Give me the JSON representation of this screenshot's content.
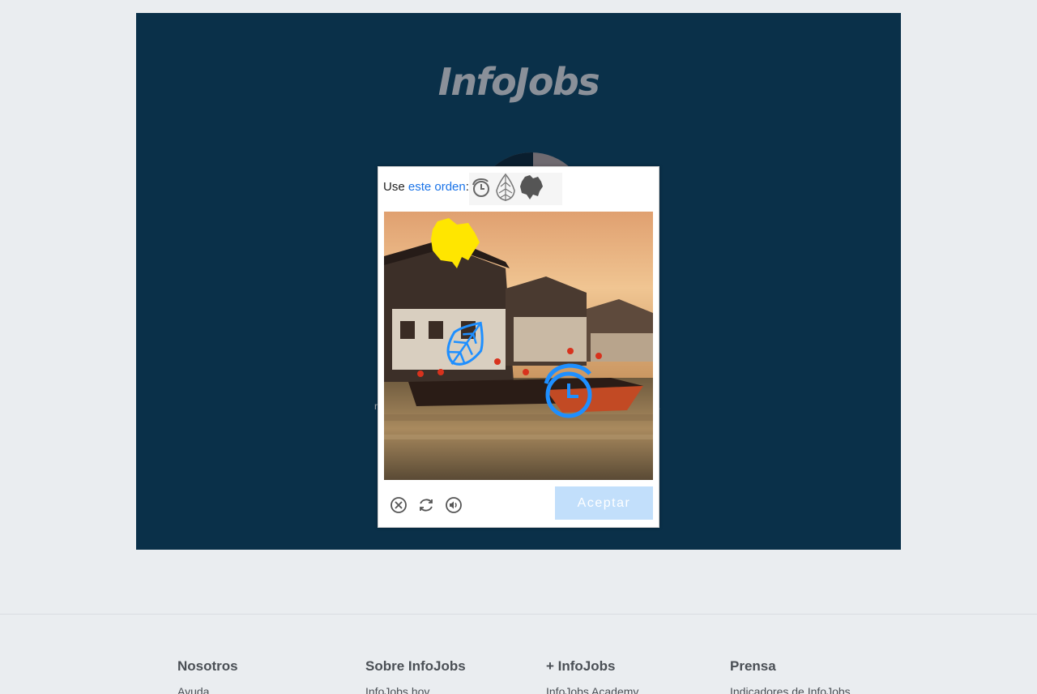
{
  "brand": {
    "logo_text": "InfoJobs"
  },
  "captcha": {
    "instruction_prefix": "Use",
    "instruction_link": "este orden",
    "instruction_suffix": ":",
    "order_icons": [
      "stopwatch-icon",
      "leaf-icon",
      "leaf-cluster-icon"
    ],
    "accept_label": "Aceptar",
    "tools": [
      "close-icon",
      "refresh-icon",
      "audio-icon"
    ],
    "targets": [
      {
        "name": "leaf-cluster-target-icon",
        "color": "#ffe600"
      },
      {
        "name": "leaf-target-icon",
        "color": "#1e8fff"
      },
      {
        "name": "stopwatch-target-icon",
        "color": "#1e8fff"
      }
    ]
  },
  "footer": {
    "columns": [
      {
        "heading": "Nosotros",
        "link": "Ayuda"
      },
      {
        "heading": "Sobre InfoJobs",
        "link": "InfoJobs hoy"
      },
      {
        "heading": "+ InfoJobs",
        "link": "InfoJobs Academy"
      },
      {
        "heading": "Prensa",
        "link": "Indicadores de InfoJobs"
      }
    ]
  },
  "colors": {
    "hero_bg": "#0a3049",
    "accent": "#1a73e8",
    "button_bg": "#c2dffb"
  }
}
